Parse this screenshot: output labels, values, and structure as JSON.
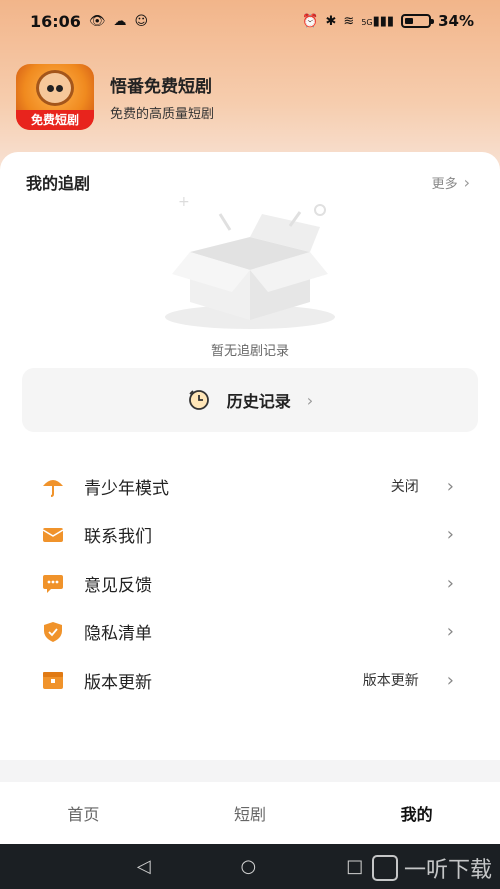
{
  "status_bar": {
    "time": "16:06",
    "battery_percent": 34,
    "battery_label": "34%",
    "signal_label": "5G",
    "icons": [
      "eye-icon",
      "weather-icon",
      "chat-icon",
      "alarm-icon",
      "bluetooth-icon",
      "wifi-icon",
      "signal-icon",
      "battery-icon"
    ]
  },
  "app": {
    "name": "悟番免费短剧",
    "tagline": "免费的高质量短剧",
    "logo_banner": "免费短剧"
  },
  "my_follow": {
    "title": "我的追剧",
    "more_label": "更多",
    "empty_text": "暂无追剧记录"
  },
  "history": {
    "label": "历史记录"
  },
  "menu": {
    "items": [
      {
        "label": "青少年模式",
        "value": "关闭",
        "icon": "umbrella-icon"
      },
      {
        "label": "联系我们",
        "value": "",
        "icon": "envelope-icon"
      },
      {
        "label": "意见反馈",
        "value": "",
        "icon": "feedback-icon"
      },
      {
        "label": "隐私清单",
        "value": "",
        "icon": "shield-icon"
      },
      {
        "label": "版本更新",
        "value": "版本更新",
        "icon": "update-box-icon"
      }
    ]
  },
  "tabs": [
    {
      "label": "首页",
      "active": false
    },
    {
      "label": "短剧",
      "active": false
    },
    {
      "label": "我的",
      "active": true
    }
  ],
  "watermark": "一听下载",
  "colors": {
    "accent": "#f0932b",
    "header_gradient_top": "#f2b58a"
  }
}
